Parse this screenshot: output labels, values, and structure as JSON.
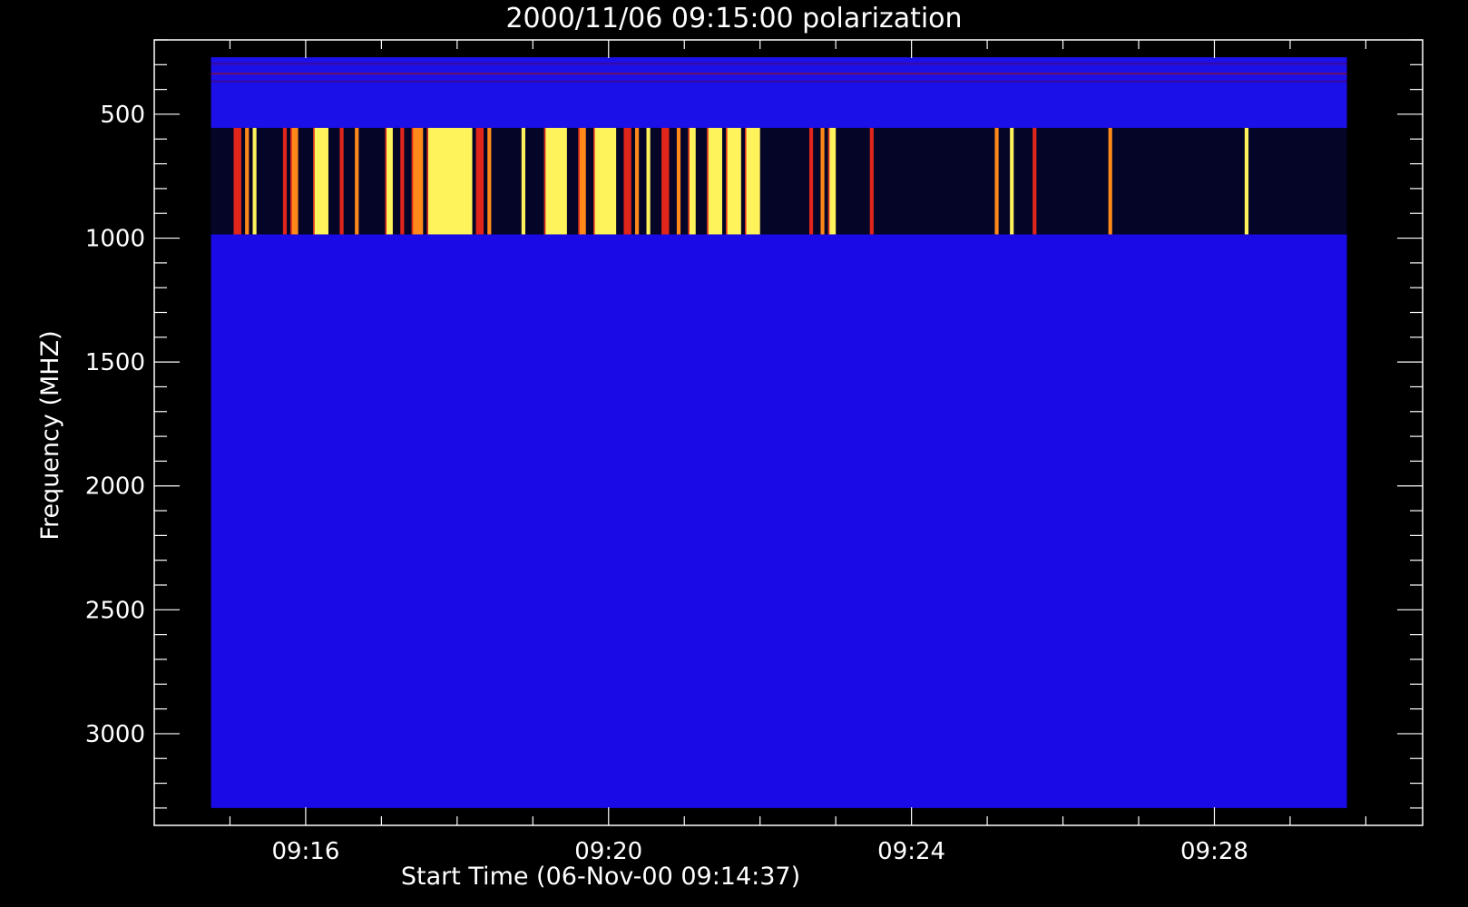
{
  "chart_data": {
    "type": "heatmap",
    "title": "2000/11/06 09:15:00 polarization",
    "xlabel": "Start Time (06-Nov-00 09:14:37)",
    "ylabel": "Frequency (MHZ)",
    "x_range_minutes": [
      14.0,
      30.75
    ],
    "y_range_mhz": [
      200,
      3370
    ],
    "y_inverted": true,
    "x_ticks": [
      "09:16",
      "09:20",
      "09:24",
      "09:28"
    ],
    "x_tick_minutes": [
      16,
      20,
      24,
      28
    ],
    "y_ticks": [
      500,
      1000,
      1500,
      2000,
      2500,
      3000
    ],
    "data_extent": {
      "x_minutes": [
        14.75,
        29.75
      ],
      "y_mhz": [
        270,
        3300
      ]
    },
    "bands": [
      {
        "y_mhz": [
          270,
          555
        ],
        "background": "#1c10e8",
        "description_color": "blue"
      },
      {
        "y_mhz": [
          555,
          985
        ],
        "background": "#050528"
      },
      {
        "y_mhz": [
          985,
          3300
        ],
        "background": "#1a0ae6"
      }
    ],
    "burst_intervals_minutes": [
      [
        15.05,
        15.15
      ],
      [
        15.2,
        15.25
      ],
      [
        15.3,
        15.35
      ],
      [
        15.7,
        15.75
      ],
      [
        15.8,
        15.9
      ],
      [
        16.1,
        16.3
      ],
      [
        16.45,
        16.5
      ],
      [
        16.65,
        16.7
      ],
      [
        17.05,
        17.15
      ],
      [
        17.25,
        17.3
      ],
      [
        17.4,
        17.55
      ],
      [
        17.6,
        18.2
      ],
      [
        18.25,
        18.35
      ],
      [
        18.4,
        18.45
      ],
      [
        18.85,
        18.9
      ],
      [
        19.15,
        19.45
      ],
      [
        19.6,
        19.7
      ],
      [
        19.8,
        20.1
      ],
      [
        20.2,
        20.3
      ],
      [
        20.35,
        20.4
      ],
      [
        20.5,
        20.55
      ],
      [
        20.7,
        20.8
      ],
      [
        20.9,
        20.95
      ],
      [
        21.05,
        21.15
      ],
      [
        21.3,
        21.5
      ],
      [
        21.55,
        21.75
      ],
      [
        21.8,
        22.0
      ],
      [
        22.65,
        22.7
      ],
      [
        22.8,
        22.85
      ],
      [
        22.9,
        23.0
      ],
      [
        23.45,
        23.5
      ],
      [
        25.1,
        25.15
      ],
      [
        25.3,
        25.35
      ],
      [
        25.6,
        25.65
      ],
      [
        26.6,
        26.65
      ],
      [
        28.4,
        28.45
      ]
    ],
    "colors": {
      "background": "#000000",
      "axes": "#ffffff",
      "burst_yellow": "#fff35c",
      "burst_orange": "#ff8a1a",
      "burst_red": "#e0261a"
    }
  }
}
